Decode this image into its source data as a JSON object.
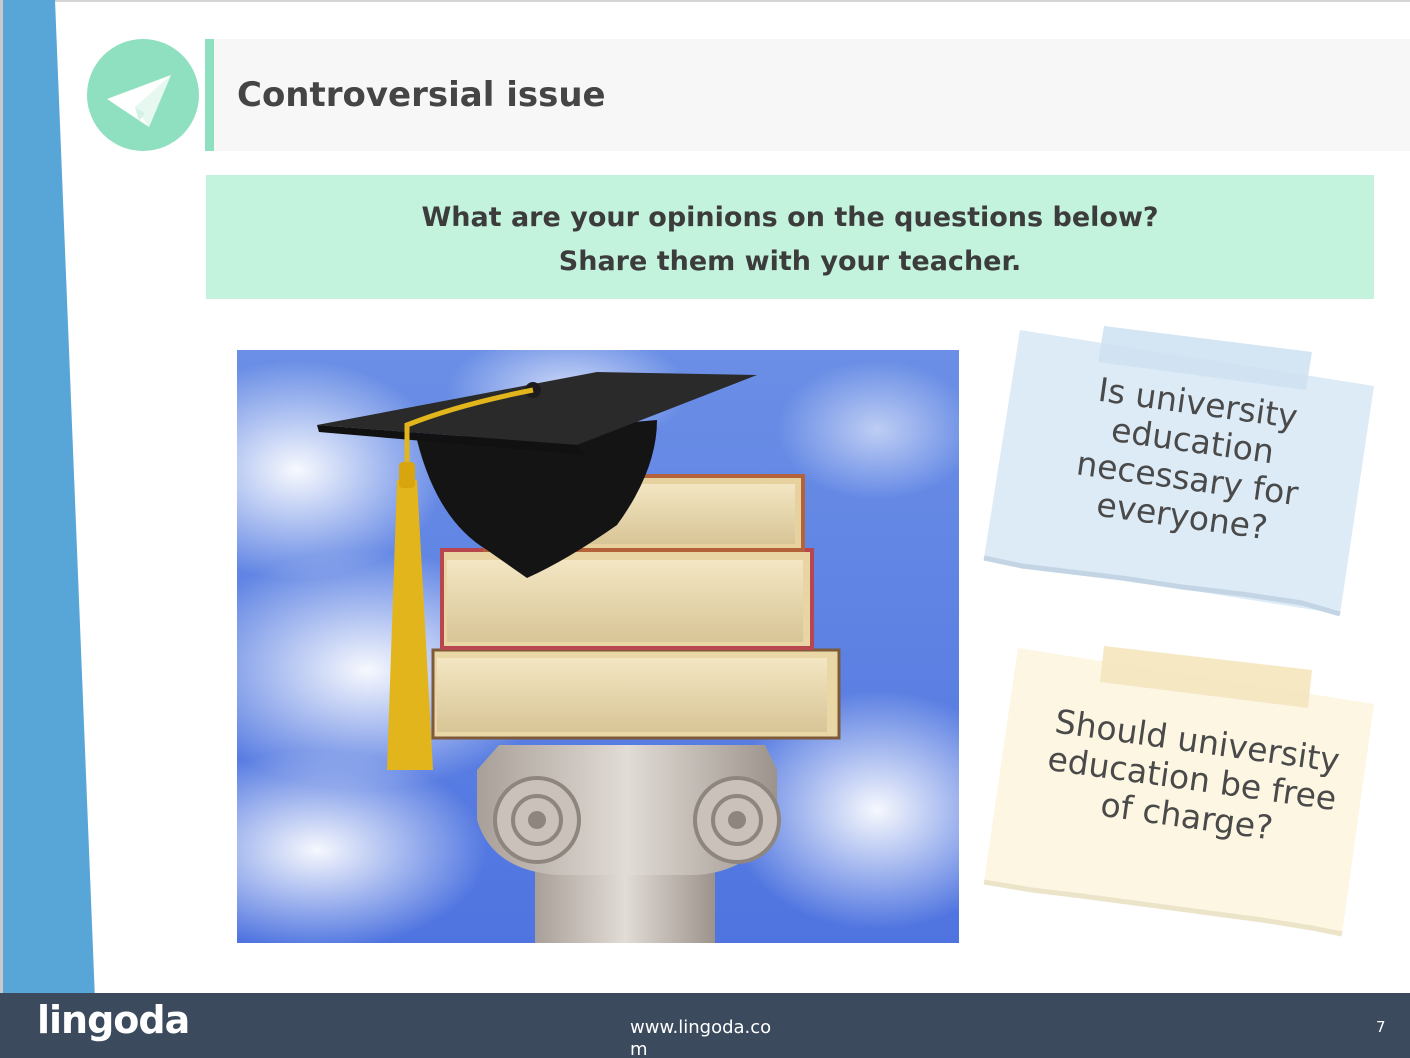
{
  "slide": {
    "title": "Controversial issue",
    "title_icon": "paper-plane-icon",
    "instruction_line1": "What are your opinions on the questions below?",
    "instruction_line2": "Share them with your teacher.",
    "image": "graduation-cap-on-books-on-column",
    "questions": [
      {
        "lines": [
          "Is university",
          "education",
          "necessary for",
          "everyone?"
        ],
        "color": "#dcebf6",
        "tape": "#cfe2f2"
      },
      {
        "lines": [
          "Should university",
          "education be free",
          "of charge?"
        ],
        "color": "#fcf6e3",
        "tape": "#f4e6bd"
      }
    ]
  },
  "footer": {
    "logo": "lingoda",
    "url": "www.lingoda.com",
    "page_number": "7"
  },
  "colors": {
    "accent_blue": "#58a5d8",
    "accent_mint": "#8fe0c0",
    "instruction_bg": "#c3f2dd",
    "footer_bg": "#3b4a5c"
  }
}
